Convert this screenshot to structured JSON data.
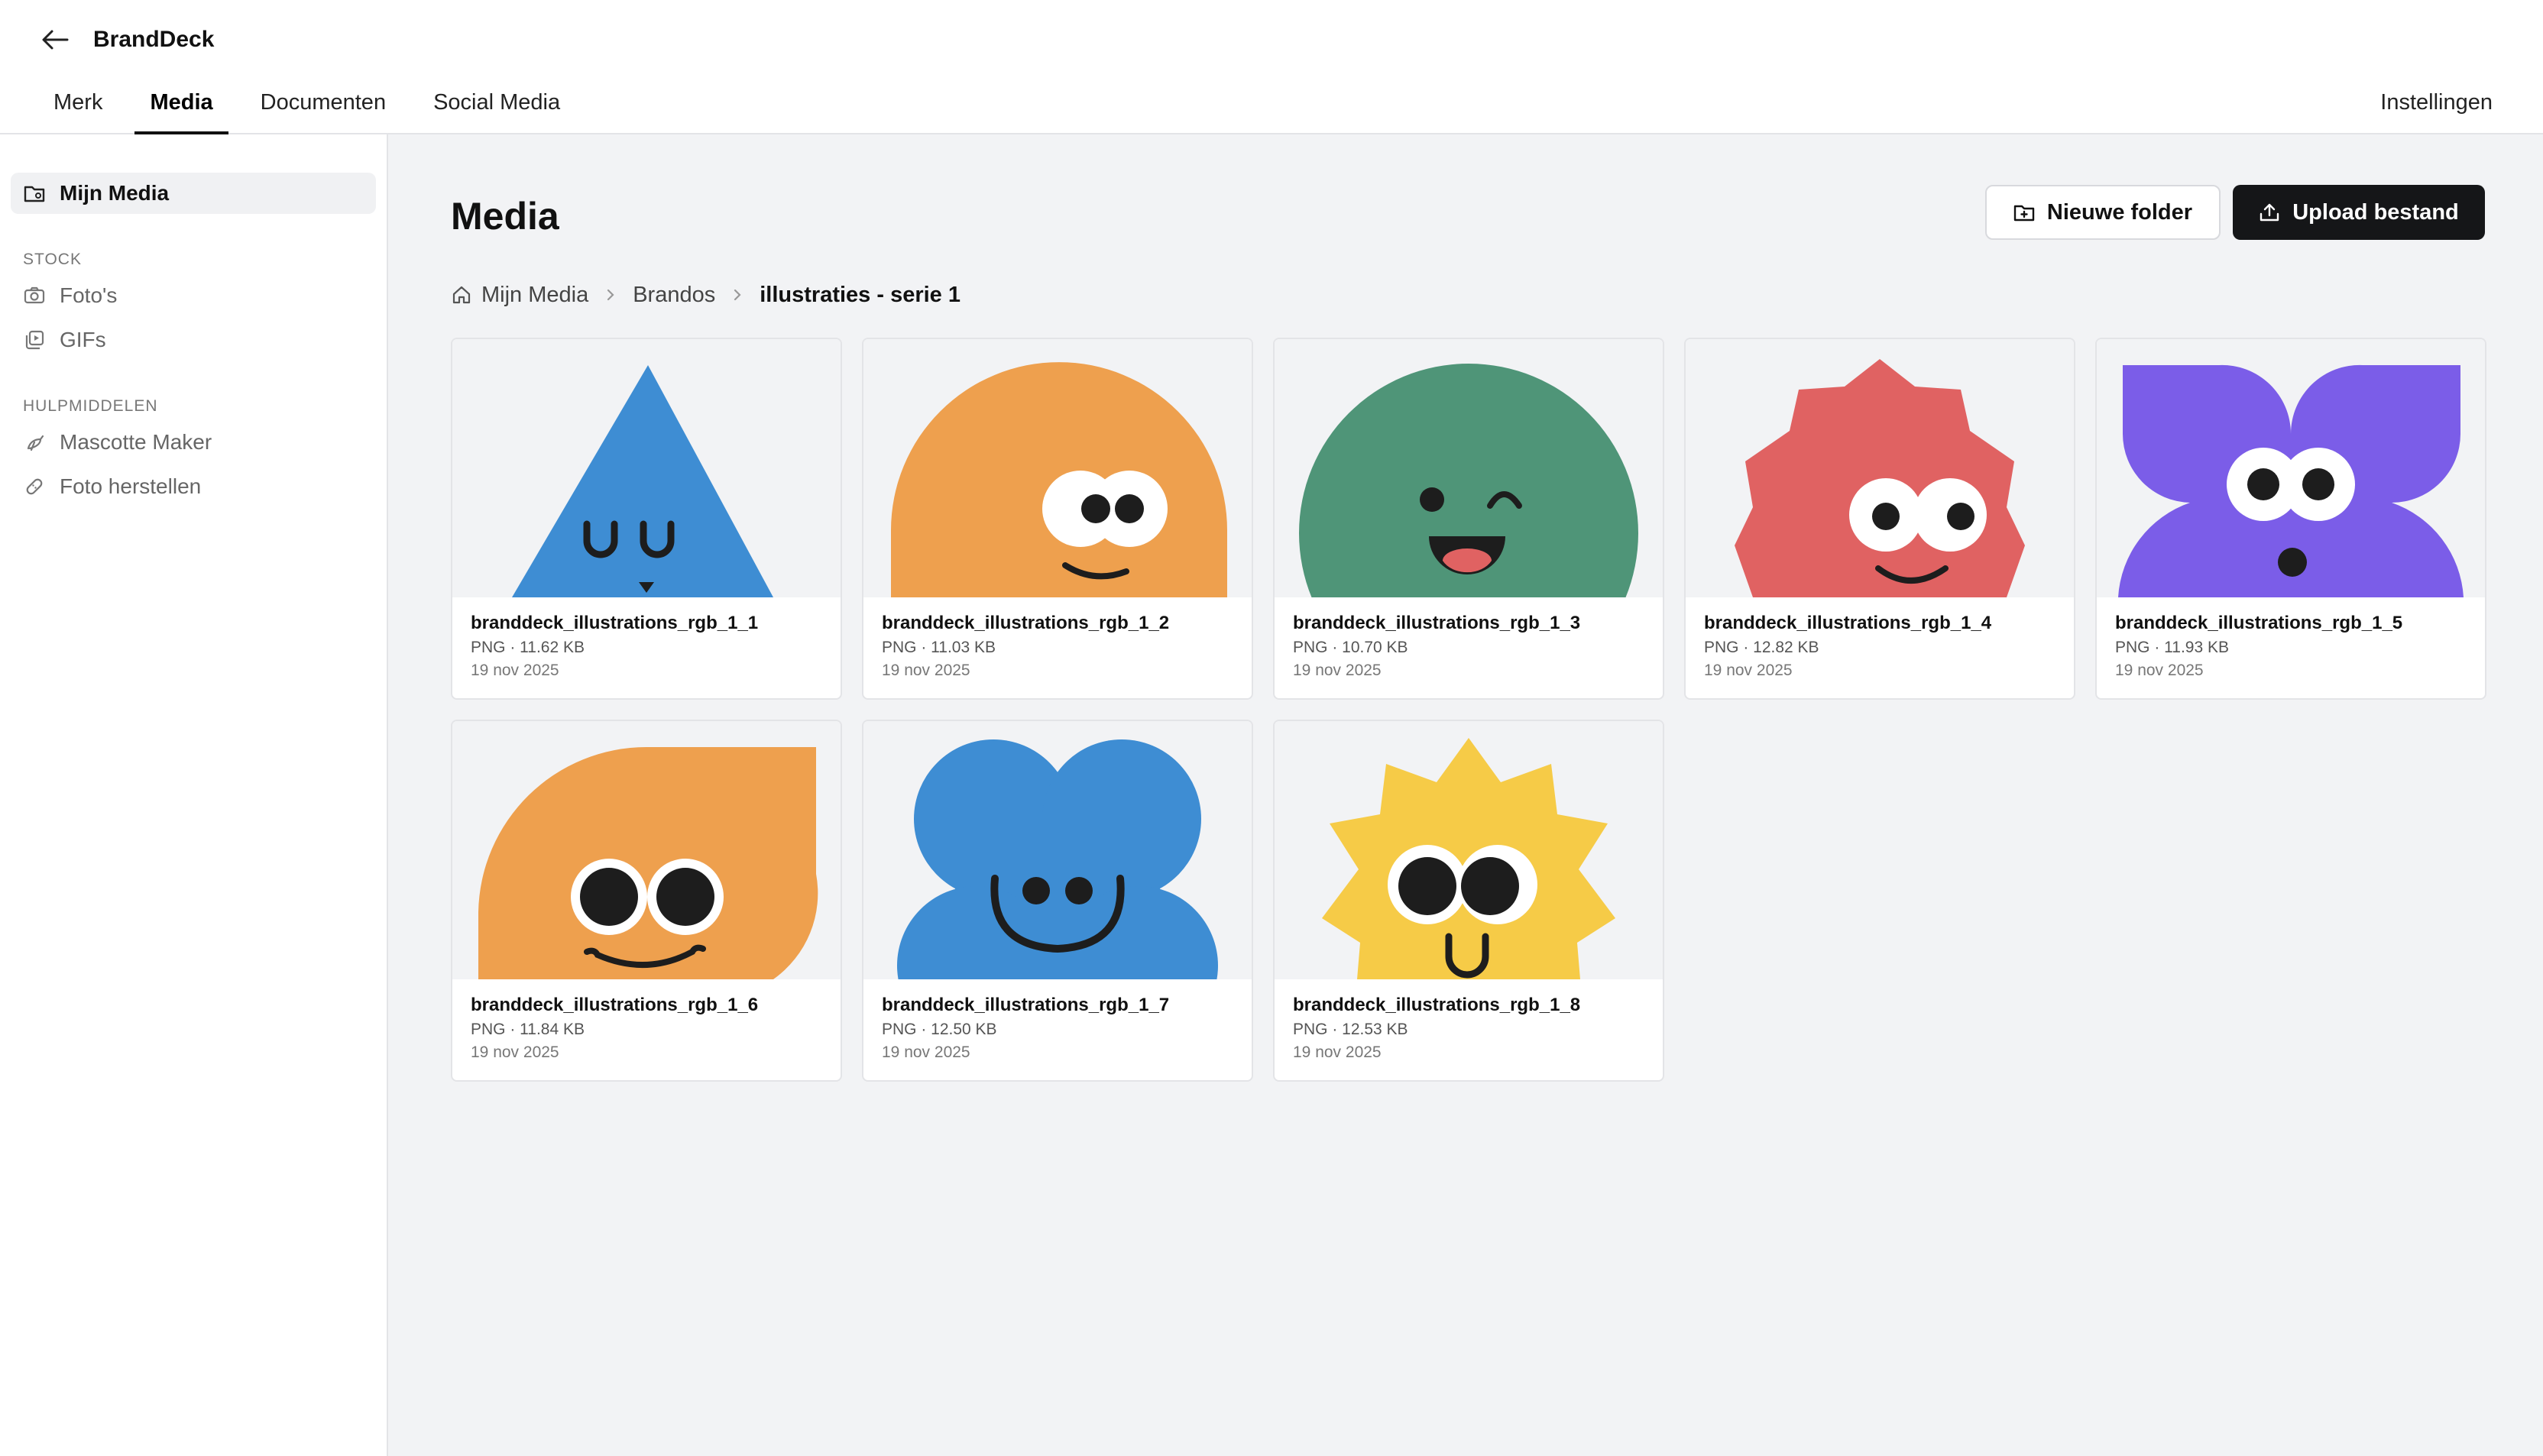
{
  "app": {
    "title": "BrandDeck",
    "back_icon": "arrow-left-icon"
  },
  "tabs": [
    {
      "label": "Merk",
      "active": false
    },
    {
      "label": "Media",
      "active": true
    },
    {
      "label": "Documenten",
      "active": false
    },
    {
      "label": "Social Media",
      "active": false
    }
  ],
  "settings_label": "Instellingen",
  "sidebar": {
    "my_media": {
      "label": "Mijn Media",
      "icon": "folder-icon",
      "active": true
    },
    "stock_heading": "STOCK",
    "stock_items": [
      {
        "label": "Foto's",
        "icon": "camera-icon"
      },
      {
        "label": "GIFs",
        "icon": "gif-icon"
      }
    ],
    "tools_heading": "HULPMIDDELEN",
    "tool_items": [
      {
        "label": "Mascotte Maker",
        "icon": "bird-icon"
      },
      {
        "label": "Foto herstellen",
        "icon": "bandage-icon"
      }
    ]
  },
  "main": {
    "title": "Media",
    "new_folder_label": "Nieuwe folder",
    "upload_label": "Upload bestand",
    "breadcrumb": [
      "Mijn Media",
      "Brandos",
      "illustraties - serie 1"
    ]
  },
  "files": [
    {
      "name": "branddeck_illustrations_rgb_1_1",
      "meta": "PNG · 11.62 KB",
      "date": "19 nov 2025",
      "color": "#3e8dd3"
    },
    {
      "name": "branddeck_illustrations_rgb_1_2",
      "meta": "PNG · 11.03 KB",
      "date": "19 nov 2025",
      "color": "#eea04e"
    },
    {
      "name": "branddeck_illustrations_rgb_1_3",
      "meta": "PNG · 10.70 KB",
      "date": "19 nov 2025",
      "color": "#4f9578"
    },
    {
      "name": "branddeck_illustrations_rgb_1_4",
      "meta": "PNG · 12.82 KB",
      "date": "19 nov 2025",
      "color": "#e06262"
    },
    {
      "name": "branddeck_illustrations_rgb_1_5",
      "meta": "PNG · 11.93 KB",
      "date": "19 nov 2025",
      "color": "#7b5de8"
    },
    {
      "name": "branddeck_illustrations_rgb_1_6",
      "meta": "PNG · 11.84 KB",
      "date": "19 nov 2025",
      "color": "#eea04e"
    },
    {
      "name": "branddeck_illustrations_rgb_1_7",
      "meta": "PNG · 12.50 KB",
      "date": "19 nov 2025",
      "color": "#3e8dd3"
    },
    {
      "name": "branddeck_illustrations_rgb_1_8",
      "meta": "PNG · 12.53 KB",
      "date": "19 nov 2025",
      "color": "#f6cb47"
    }
  ]
}
